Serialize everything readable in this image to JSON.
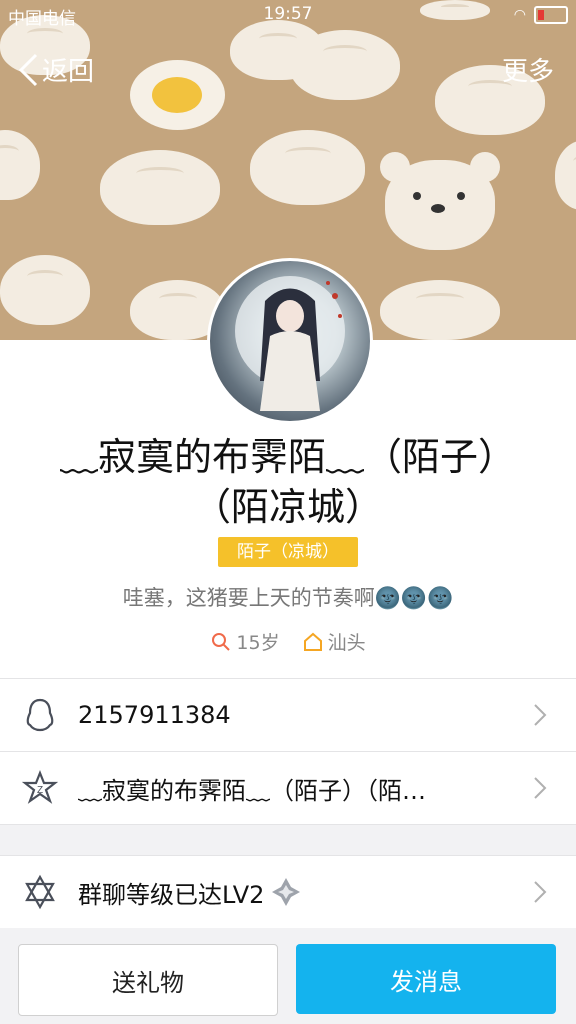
{
  "status_bar": {
    "carrier": "中国电信",
    "time": "19:57"
  },
  "nav": {
    "back_label": "返回",
    "more_label": "更多"
  },
  "profile": {
    "nickname": "﹏寂寞的布霁陌﹏（陌子）（陌凉城）",
    "tag": "陌子（凉城）",
    "signature": "哇塞，这猪要上天的节奏啊🌚🌚🌚",
    "age": "15岁",
    "location": "汕头"
  },
  "rows": {
    "qq_number": "2157911384",
    "group_nickname": "﹏寂寞的布霁陌﹏（陌子）（陌…",
    "group_level": "群聊等级已达LV2"
  },
  "buttons": {
    "gift": "送礼物",
    "message": "发消息"
  },
  "colors": {
    "accent": "#14b3ee",
    "tag": "#f5c12a",
    "header": "#c4a57e"
  },
  "icons": [
    "back-chevron-icon",
    "search-age-icon",
    "home-icon",
    "penguin-icon",
    "star-badge-icon",
    "hexagram-icon",
    "diamond-badge-icon",
    "chevron-right-icon"
  ]
}
